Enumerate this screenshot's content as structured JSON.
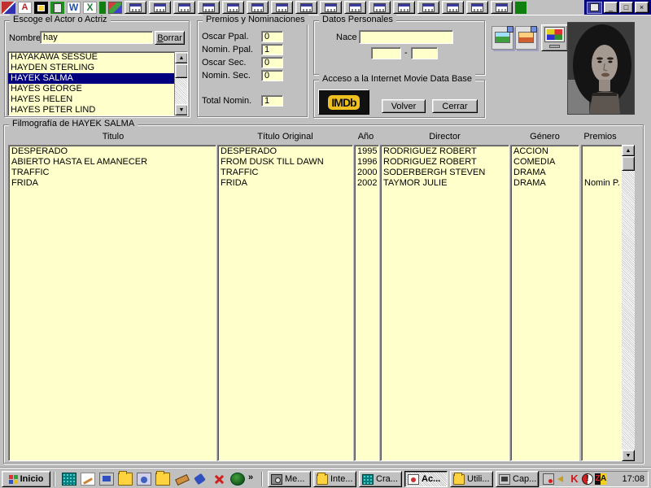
{
  "window": {
    "minimize": "_",
    "maximize": "□",
    "close": "×"
  },
  "shortcut_bar": {
    "app2_label": "A",
    "word_label": "W",
    "excel_label": "X",
    "launcher_repeat_count": 16,
    "icon_names": [
      "paint-app",
      "font-app",
      "black-app",
      "clipboard-green-app",
      "word",
      "excel",
      "separator",
      "cards-app",
      "launcher-window"
    ]
  },
  "actor_panel": {
    "title": "Escoge el Actor o Actriz",
    "name_label": "Nombre",
    "name_value": "hay",
    "clear_button": "Borrar",
    "actors": [
      "HAYAKAWA SESSUE",
      "HAYDEN STERLING",
      "HAYEK SALMA",
      "HAYES GEORGE",
      "HAYES HELEN",
      "HAYES PETER LIND"
    ],
    "selected_actor": "HAYEK SALMA",
    "selected_index": 2
  },
  "awards_panel": {
    "title": "Premios y Nominaciones",
    "rows": [
      {
        "label": "Oscar Ppal.",
        "value": "0"
      },
      {
        "label": "Nomin. Ppal.",
        "value": "1"
      },
      {
        "label": "Oscar Sec.",
        "value": "0"
      },
      {
        "label": "Nomin. Sec.",
        "value": "0"
      }
    ],
    "total_label": "Total Nomin.",
    "total_value": "1"
  },
  "personal_panel": {
    "title": "Datos Personales",
    "born_label": "Nace",
    "born_value": "",
    "date_value_1": "",
    "date_separator": "-",
    "date_value_2": ""
  },
  "imdb_panel": {
    "title": "Acceso a la Internet Movie Data Base",
    "logo_text": "IMDb",
    "volver_button": "Volver",
    "cerrar_button": "Cerrar"
  },
  "filmography": {
    "title": "Filmografía de HAYEK SALMA",
    "headers": {
      "titulo": "Titulo",
      "titulo_original": "Título Original",
      "ano": "Año",
      "director": "Director",
      "genero": "Género",
      "premios": "Premios"
    },
    "rows": [
      {
        "titulo": "DESPERADO",
        "titulo_original": "DESPERADO",
        "ano": "1995",
        "director": "RODRIGUEZ ROBERT",
        "genero": "ACCION",
        "premios": ""
      },
      {
        "titulo": "ABIERTO HASTA EL AMANECER",
        "titulo_original": "FROM DUSK TILL DAWN",
        "ano": "1996",
        "director": "RODRIGUEZ ROBERT",
        "genero": "COMEDIA",
        "premios": ""
      },
      {
        "titulo": "TRAFFIC",
        "titulo_original": "TRAFFIC",
        "ano": "2000",
        "director": "SODERBERGH STEVEN",
        "genero": "DRAMA",
        "premios": ""
      },
      {
        "titulo": "FRIDA",
        "titulo_original": "FRIDA",
        "ano": "2002",
        "director": "TAYMOR JULIE",
        "genero": "DRAMA",
        "premios": "Nomin P."
      }
    ]
  },
  "taskbar": {
    "start_button": "Inicio",
    "quick_launch_icons": [
      "crazy-browser",
      "notepad",
      "show-desktop",
      "folder-open",
      "cd-tool",
      "folder",
      "paintbrush",
      "phone-dialer",
      "red-asterisk",
      "green-ball"
    ],
    "overflow_chevron": "»",
    "tasks": [
      {
        "label": "Me...",
        "active": false
      },
      {
        "label": "Inte...",
        "active": false
      },
      {
        "label": "Cra...",
        "active": false
      },
      {
        "label": "Ac...",
        "active": true
      },
      {
        "label": "Utili...",
        "active": false
      },
      {
        "label": "Cap...",
        "active": false
      }
    ],
    "tray_icons": [
      "task-scheduler",
      "volume",
      "antivirus-k",
      "alert",
      "zonealarm"
    ],
    "clock": "17:08"
  },
  "icons": {
    "arrow_up": "▲",
    "arrow_down": "▼",
    "kaspersky_label": "K",
    "alert_mark": "!",
    "zonealarm_z": "Z",
    "zonealarm_a": "A"
  },
  "colors": {
    "field_yellow": "#ffffcc",
    "selection_navy": "#00007f",
    "chrome_gray": "#c0c0c0",
    "imdb_yellow": "#f0c020"
  }
}
